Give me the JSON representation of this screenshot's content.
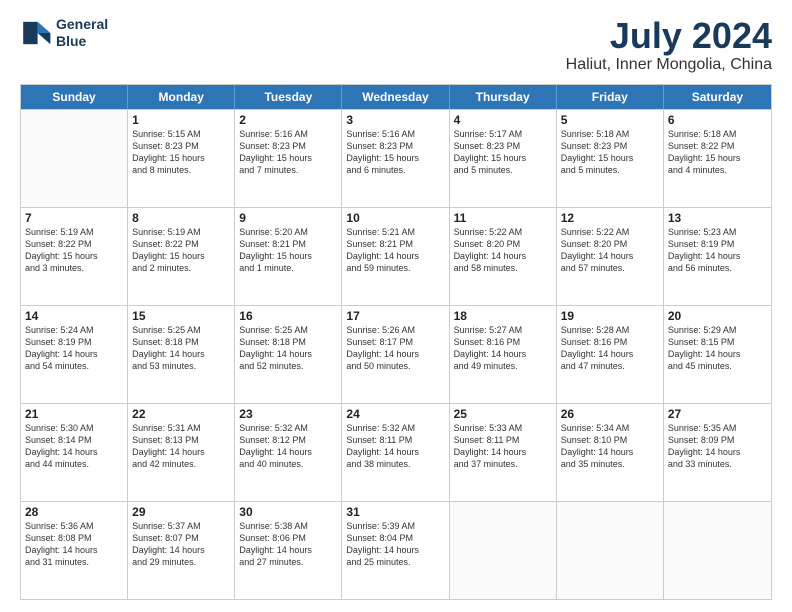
{
  "logo": {
    "line1": "General",
    "line2": "Blue"
  },
  "title": "July 2024",
  "subtitle": "Haliut, Inner Mongolia, China",
  "header_days": [
    "Sunday",
    "Monday",
    "Tuesday",
    "Wednesday",
    "Thursday",
    "Friday",
    "Saturday"
  ],
  "rows": [
    [
      {
        "day": "",
        "lines": []
      },
      {
        "day": "1",
        "lines": [
          "Sunrise: 5:15 AM",
          "Sunset: 8:23 PM",
          "Daylight: 15 hours",
          "and 8 minutes."
        ]
      },
      {
        "day": "2",
        "lines": [
          "Sunrise: 5:16 AM",
          "Sunset: 8:23 PM",
          "Daylight: 15 hours",
          "and 7 minutes."
        ]
      },
      {
        "day": "3",
        "lines": [
          "Sunrise: 5:16 AM",
          "Sunset: 8:23 PM",
          "Daylight: 15 hours",
          "and 6 minutes."
        ]
      },
      {
        "day": "4",
        "lines": [
          "Sunrise: 5:17 AM",
          "Sunset: 8:23 PM",
          "Daylight: 15 hours",
          "and 5 minutes."
        ]
      },
      {
        "day": "5",
        "lines": [
          "Sunrise: 5:18 AM",
          "Sunset: 8:23 PM",
          "Daylight: 15 hours",
          "and 5 minutes."
        ]
      },
      {
        "day": "6",
        "lines": [
          "Sunrise: 5:18 AM",
          "Sunset: 8:22 PM",
          "Daylight: 15 hours",
          "and 4 minutes."
        ]
      }
    ],
    [
      {
        "day": "7",
        "lines": [
          "Sunrise: 5:19 AM",
          "Sunset: 8:22 PM",
          "Daylight: 15 hours",
          "and 3 minutes."
        ]
      },
      {
        "day": "8",
        "lines": [
          "Sunrise: 5:19 AM",
          "Sunset: 8:22 PM",
          "Daylight: 15 hours",
          "and 2 minutes."
        ]
      },
      {
        "day": "9",
        "lines": [
          "Sunrise: 5:20 AM",
          "Sunset: 8:21 PM",
          "Daylight: 15 hours",
          "and 1 minute."
        ]
      },
      {
        "day": "10",
        "lines": [
          "Sunrise: 5:21 AM",
          "Sunset: 8:21 PM",
          "Daylight: 14 hours",
          "and 59 minutes."
        ]
      },
      {
        "day": "11",
        "lines": [
          "Sunrise: 5:22 AM",
          "Sunset: 8:20 PM",
          "Daylight: 14 hours",
          "and 58 minutes."
        ]
      },
      {
        "day": "12",
        "lines": [
          "Sunrise: 5:22 AM",
          "Sunset: 8:20 PM",
          "Daylight: 14 hours",
          "and 57 minutes."
        ]
      },
      {
        "day": "13",
        "lines": [
          "Sunrise: 5:23 AM",
          "Sunset: 8:19 PM",
          "Daylight: 14 hours",
          "and 56 minutes."
        ]
      }
    ],
    [
      {
        "day": "14",
        "lines": [
          "Sunrise: 5:24 AM",
          "Sunset: 8:19 PM",
          "Daylight: 14 hours",
          "and 54 minutes."
        ]
      },
      {
        "day": "15",
        "lines": [
          "Sunrise: 5:25 AM",
          "Sunset: 8:18 PM",
          "Daylight: 14 hours",
          "and 53 minutes."
        ]
      },
      {
        "day": "16",
        "lines": [
          "Sunrise: 5:25 AM",
          "Sunset: 8:18 PM",
          "Daylight: 14 hours",
          "and 52 minutes."
        ]
      },
      {
        "day": "17",
        "lines": [
          "Sunrise: 5:26 AM",
          "Sunset: 8:17 PM",
          "Daylight: 14 hours",
          "and 50 minutes."
        ]
      },
      {
        "day": "18",
        "lines": [
          "Sunrise: 5:27 AM",
          "Sunset: 8:16 PM",
          "Daylight: 14 hours",
          "and 49 minutes."
        ]
      },
      {
        "day": "19",
        "lines": [
          "Sunrise: 5:28 AM",
          "Sunset: 8:16 PM",
          "Daylight: 14 hours",
          "and 47 minutes."
        ]
      },
      {
        "day": "20",
        "lines": [
          "Sunrise: 5:29 AM",
          "Sunset: 8:15 PM",
          "Daylight: 14 hours",
          "and 45 minutes."
        ]
      }
    ],
    [
      {
        "day": "21",
        "lines": [
          "Sunrise: 5:30 AM",
          "Sunset: 8:14 PM",
          "Daylight: 14 hours",
          "and 44 minutes."
        ]
      },
      {
        "day": "22",
        "lines": [
          "Sunrise: 5:31 AM",
          "Sunset: 8:13 PM",
          "Daylight: 14 hours",
          "and 42 minutes."
        ]
      },
      {
        "day": "23",
        "lines": [
          "Sunrise: 5:32 AM",
          "Sunset: 8:12 PM",
          "Daylight: 14 hours",
          "and 40 minutes."
        ]
      },
      {
        "day": "24",
        "lines": [
          "Sunrise: 5:32 AM",
          "Sunset: 8:11 PM",
          "Daylight: 14 hours",
          "and 38 minutes."
        ]
      },
      {
        "day": "25",
        "lines": [
          "Sunrise: 5:33 AM",
          "Sunset: 8:11 PM",
          "Daylight: 14 hours",
          "and 37 minutes."
        ]
      },
      {
        "day": "26",
        "lines": [
          "Sunrise: 5:34 AM",
          "Sunset: 8:10 PM",
          "Daylight: 14 hours",
          "and 35 minutes."
        ]
      },
      {
        "day": "27",
        "lines": [
          "Sunrise: 5:35 AM",
          "Sunset: 8:09 PM",
          "Daylight: 14 hours",
          "and 33 minutes."
        ]
      }
    ],
    [
      {
        "day": "28",
        "lines": [
          "Sunrise: 5:36 AM",
          "Sunset: 8:08 PM",
          "Daylight: 14 hours",
          "and 31 minutes."
        ]
      },
      {
        "day": "29",
        "lines": [
          "Sunrise: 5:37 AM",
          "Sunset: 8:07 PM",
          "Daylight: 14 hours",
          "and 29 minutes."
        ]
      },
      {
        "day": "30",
        "lines": [
          "Sunrise: 5:38 AM",
          "Sunset: 8:06 PM",
          "Daylight: 14 hours",
          "and 27 minutes."
        ]
      },
      {
        "day": "31",
        "lines": [
          "Sunrise: 5:39 AM",
          "Sunset: 8:04 PM",
          "Daylight: 14 hours",
          "and 25 minutes."
        ]
      },
      {
        "day": "",
        "lines": []
      },
      {
        "day": "",
        "lines": []
      },
      {
        "day": "",
        "lines": []
      }
    ]
  ]
}
